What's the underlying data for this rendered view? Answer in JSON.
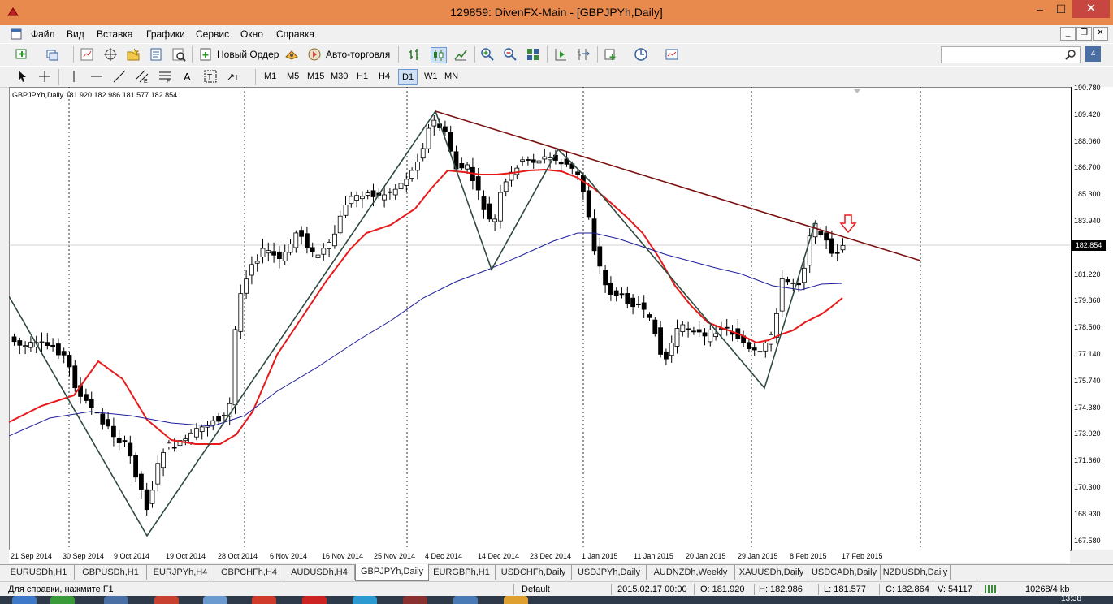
{
  "window": {
    "title": "129859: DivenFX-Main - [GBPJPYh,Daily]",
    "minimize": "‒",
    "maximize": "☐",
    "close": "✕"
  },
  "menu": [
    "Файл",
    "Вид",
    "Вставка",
    "Графики",
    "Сервис",
    "Окно",
    "Справка"
  ],
  "toolbar": {
    "new_order_label": "Новый Ордер",
    "auto_trading_label": "Авто-торговля",
    "search_placeholder": "",
    "notifications_count": "4"
  },
  "timeframes": [
    "M1",
    "M5",
    "M15",
    "M30",
    "H1",
    "H4",
    "D1",
    "W1",
    "MN"
  ],
  "active_timeframe": "D1",
  "chart": {
    "header": "GBPJPYh,Daily  181.920 182.986 181.577 182.854",
    "current_price": "182.854",
    "price_labels": [
      "190.780",
      "189.420",
      "188.060",
      "186.700",
      "185.300",
      "183.940",
      "182.580",
      "181.220",
      "179.860",
      "178.500",
      "177.140",
      "175.740",
      "174.380",
      "173.020",
      "171.660",
      "170.300",
      "168.930",
      "167.580"
    ],
    "time_labels": [
      "21 Sep 2014",
      "30 Sep 2014",
      "9 Oct 2014",
      "19 Oct 2014",
      "28 Oct 2014",
      "6 Nov 2014",
      "16 Nov 2014",
      "25 Nov 2014",
      "4 Dec 2014",
      "14 Dec 2014",
      "23 Dec 2014",
      "1 Jan 2015",
      "11 Jan 2015",
      "20 Jan 2015",
      "29 Jan 2015",
      "8 Feb 2015",
      "17 Feb 2015"
    ],
    "colors": {
      "bull_candle": "#ffffff",
      "bear_candle": "#000000",
      "ma_fast": "#e8191a",
      "ma_slow": "#1c1c9a",
      "zigzag": "#2f4a40",
      "trendline": "#7a1010",
      "signal_arrow": "#e8191a"
    }
  },
  "tabs": [
    "EURUSDh,H1",
    "GBPUSDh,H1",
    "EURJPYh,H4",
    "GBPCHFh,H4",
    "AUDUSDh,H4",
    "GBPJPYh,Daily",
    "EURGBPh,H1",
    "USDCHFh,Daily",
    "USDJPYh,Daily",
    "AUDNZDh,Weekly",
    "XAUUSDh,Daily",
    "USDCADh,Daily",
    "NZDUSDh,Daily"
  ],
  "active_tab": "GBPJPYh,Daily",
  "status": {
    "help": "Для справки, нажмите F1",
    "profile": "Default",
    "datetime": "2015.02.17 00:00",
    "open": "O: 181.920",
    "high": "H: 182.986",
    "low": "L: 181.577",
    "close": "C: 182.864",
    "volume": "V: 54117",
    "traffic": "10268/4 kb"
  },
  "taskbar": {
    "clock": "13:38"
  }
}
